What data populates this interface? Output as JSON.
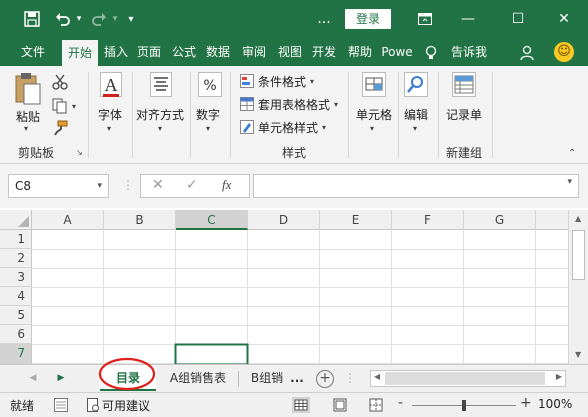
{
  "titlebar": {
    "save_icon": "save-icon",
    "undo_icon": "undo-icon",
    "redo_icon": "redo-icon",
    "more_label": "▾",
    "ellipsis": "...",
    "login_label": "登录",
    "restore_ribbon_icon": "ribbon-display-icon",
    "minimize": "—",
    "maximize": "☐",
    "close": "✕"
  },
  "tabs": [
    "文件",
    "开始",
    "插入",
    "页面",
    "公式",
    "数据",
    "审阅",
    "视图",
    "开发",
    "帮助",
    "Powe",
    "告诉我"
  ],
  "active_tab": "开始",
  "tellme_icon": "lightbulb-icon",
  "share_icon": "person-icon",
  "ribbon": {
    "clipboard": {
      "paste": "粘贴",
      "group": "剪贴板"
    },
    "font": {
      "label": "字体"
    },
    "align": {
      "label": "对齐方式"
    },
    "number": {
      "label": "数字"
    },
    "styles": {
      "cond_format": "条件格式",
      "table_format": "套用表格格式",
      "cell_style": "单元格样式",
      "group": "样式"
    },
    "cells": {
      "label": "单元格"
    },
    "edit": {
      "label": "编辑"
    },
    "newgroup": {
      "label": "记录单",
      "group": "新建组"
    }
  },
  "formula_bar": {
    "name_box": "C8",
    "cancel": "✕",
    "confirm": "✓",
    "fx": "fx",
    "value": ""
  },
  "grid": {
    "columns": [
      "A",
      "B",
      "C",
      "D",
      "E",
      "F",
      "G"
    ],
    "rows": [
      "1",
      "2",
      "3",
      "4",
      "5",
      "6",
      "7"
    ],
    "selected_column": "C",
    "selected_row": "7"
  },
  "sheets": {
    "tabs": [
      "目录",
      "A组销售表",
      "B组销"
    ],
    "active": "目录",
    "more": "...",
    "add": "+"
  },
  "status": {
    "ready": "就绪",
    "accessibility": "可用建议",
    "zoom": "100%",
    "zoom_minus": "-",
    "zoom_plus": "+"
  },
  "colors": {
    "brand": "#217346",
    "highlight_circle": "#e0201b"
  }
}
